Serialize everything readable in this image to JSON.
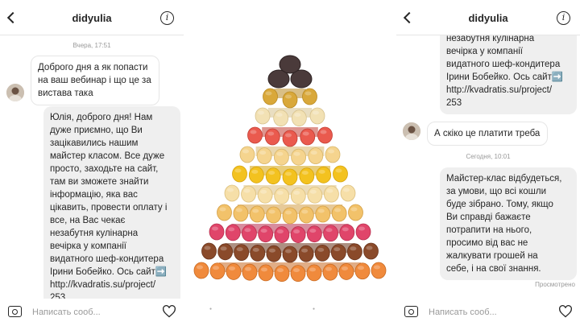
{
  "left_chat": {
    "username": "didyulia",
    "timestamp": "Вчера, 17:51",
    "incoming_message": "Доброго дня а як попасти на ваш вебинар і що це за вистава така",
    "outgoing_message": {
      "lines": [
        "Юлія, доброго дня! Нам",
        "дуже приємно, що Ви",
        "зацікавились нашим",
        "майстер класом. Все дуже",
        "просто, заходьте на сайт,",
        "там ви зможете знайти",
        "інформацію, яка вас",
        "цікавить, провести оплату і",
        "все, на Вас чекає",
        "незабутня кулінарна",
        "вечірка у компанії",
        "видатного шеф-кондитера",
        "Ірини Бобейко. Ось сайт➡️",
        "http://kvadratis.su/project/",
        "253"
      ]
    },
    "input_placeholder": "Написать сооб..."
  },
  "right_chat": {
    "username": "didyulia",
    "continued_message": {
      "lines": [
        "незабутня кулінарна",
        "вечірка у компанії",
        "видатного шеф-кондитера",
        "Ірини Бобейко. Ось сайт➡️",
        "http://kvadratis.su/project/",
        "253"
      ]
    },
    "incoming_message": "А скіко це платити треба",
    "timestamp": "Сегодня, 10:01",
    "outgoing_message": {
      "lines": [
        "Майстер-клас відбудеться,",
        "за умови, що всі кошли",
        "буде зібрано. Тому, якщо",
        "Ви справді бажаєте",
        "потрапити на нього,",
        "просимо від вас не",
        "жалкувати грошей на",
        "себе, і на свої знання."
      ]
    },
    "seen_label": "Просмотрено",
    "input_placeholder": "Написать сооб..."
  },
  "colors": {
    "outgoing_bubble": "#efefef",
    "incoming_border": "#e6e6e6",
    "text": "#262626",
    "muted": "#999999"
  },
  "icons": [
    "back-chevron-icon",
    "info-icon",
    "camera-icon",
    "heart-icon"
  ]
}
